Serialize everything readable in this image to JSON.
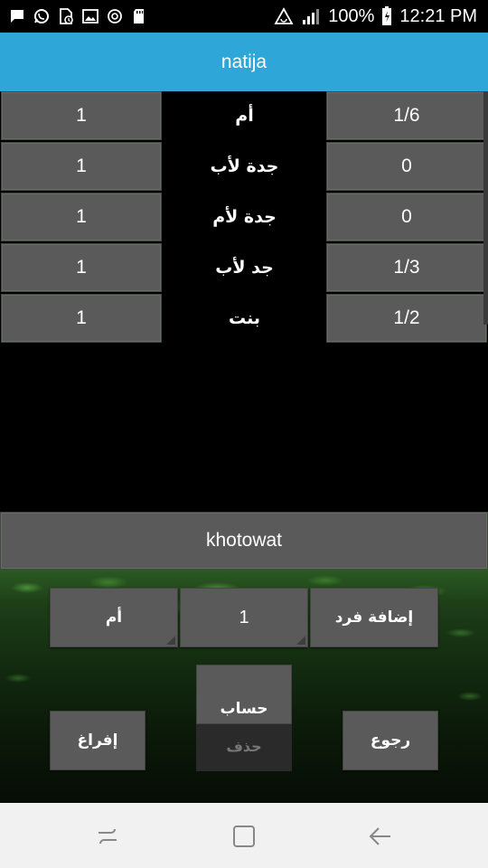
{
  "status_bar": {
    "left_icons": [
      "message-icon",
      "whatsapp-icon",
      "sim-card-alert-icon",
      "image-icon",
      "sync-icon",
      "sd-card-icon"
    ],
    "right_icons": [
      "data-saver-icon",
      "signal-icon",
      "battery-icon"
    ],
    "battery_text": "100%",
    "time": "12:21 PM"
  },
  "title_bar": {
    "title": "natija"
  },
  "results": {
    "rows": [
      {
        "count": "1",
        "name": "أم",
        "share": "1/6"
      },
      {
        "count": "1",
        "name": "جدة لأب",
        "share": "0"
      },
      {
        "count": "1",
        "name": "جدة لأم",
        "share": "0"
      },
      {
        "count": "1",
        "name": "جد لأب",
        "share": "1/3"
      },
      {
        "count": "1",
        "name": "بنت",
        "share": "1/2"
      }
    ]
  },
  "steps_button": {
    "label": "khotowat"
  },
  "controls": {
    "heir_select": "أم",
    "count_select": "1",
    "add_button": "إضافة فرد",
    "calc_button": "حساب",
    "delete_button": "حذف",
    "clear_button": "إفراغ",
    "back_button": "رجوع"
  },
  "nav_bar": {
    "icons": [
      "recent-apps-icon",
      "home-icon",
      "back-icon"
    ]
  },
  "colors": {
    "title_bar": "#2ea6d8",
    "button_gray": "#5a5a5a",
    "nav_bar": "#f1f1f1"
  }
}
